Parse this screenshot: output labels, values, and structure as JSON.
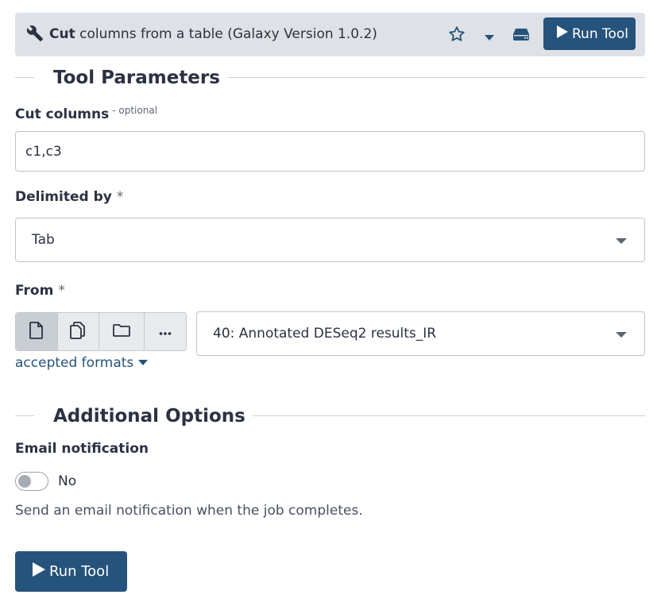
{
  "header": {
    "tool_name": "Cut",
    "tool_desc": "columns from a table (Galaxy Version 1.0.2)",
    "run_label": "Run Tool",
    "icons": [
      "wrench-icon",
      "star-icon",
      "caret-down-icon",
      "hdd-icon",
      "play-icon"
    ]
  },
  "sections": {
    "tool_parameters": "Tool Parameters",
    "additional_options": "Additional Options"
  },
  "cut_columns": {
    "label": "Cut columns",
    "optional": "- optional",
    "value": "c1,c3"
  },
  "delimited_by": {
    "label": "Delimited by",
    "required": "*",
    "value": "Tab"
  },
  "from": {
    "label": "From",
    "required": "*",
    "value": "40: Annotated DESeq2 results_IR",
    "accepted_formats": "accepted formats",
    "source_icons": [
      "file-icon",
      "files-icon",
      "folder-icon",
      "ellipsis-icon"
    ]
  },
  "email": {
    "label": "Email notification",
    "toggle_value": "No",
    "help": "Send an email notification when the job completes."
  },
  "run_bottom_label": "Run Tool",
  "colors": {
    "primary": "#25537b",
    "header_bg": "#dee2e6",
    "text": "#2c3143"
  }
}
